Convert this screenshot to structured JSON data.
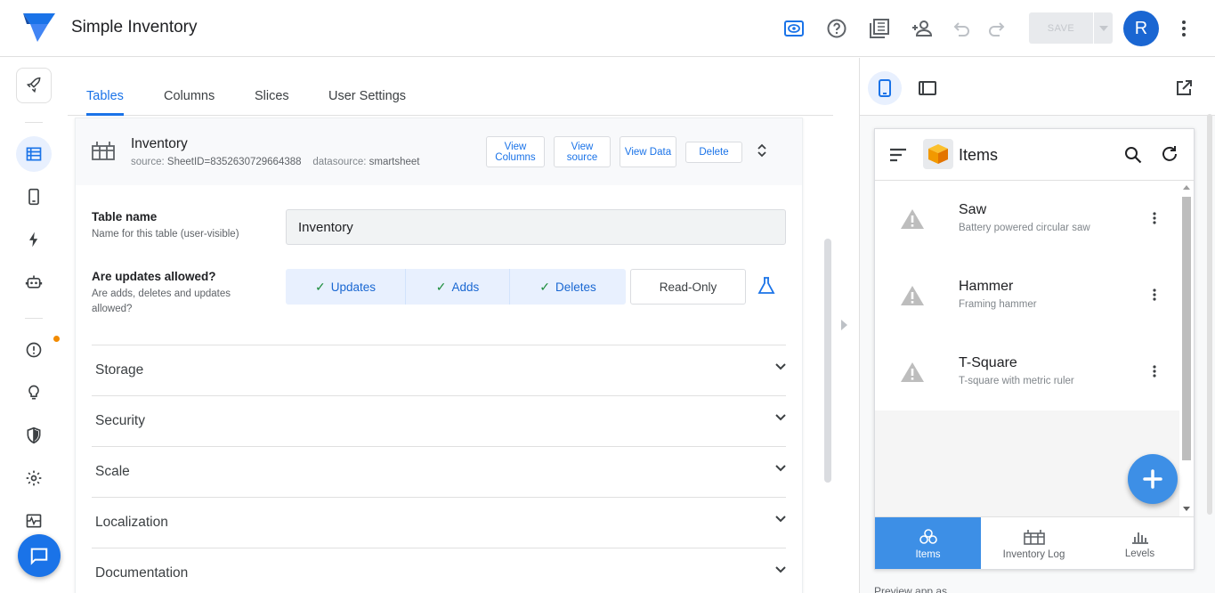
{
  "app": {
    "title": "Simple Inventory",
    "save_label": "SAVE",
    "avatar_initial": "R",
    "accent": "#1a73e8"
  },
  "tabs": [
    {
      "label": "Tables",
      "active": true
    },
    {
      "label": "Columns",
      "active": false
    },
    {
      "label": "Slices",
      "active": false
    },
    {
      "label": "User Settings",
      "active": false
    }
  ],
  "table": {
    "name": "Inventory",
    "source_key": "source:",
    "source_value": "SheetID=8352630729664388",
    "datasource_key": "datasource:",
    "datasource_value": "smartsheet",
    "buttons": {
      "view_columns": "View Columns",
      "view_source": "View source",
      "view_data": "View Data",
      "delete": "Delete"
    }
  },
  "fields": {
    "table_name_label": "Table name",
    "table_name_help": "Name for this table (user-visible)",
    "table_name_value": "Inventory",
    "updates_label": "Are updates allowed?",
    "updates_help": "Are adds, deletes and updates allowed?",
    "updates": "Updates",
    "adds": "Adds",
    "deletes": "Deletes",
    "read_only": "Read-Only"
  },
  "sections": [
    "Storage",
    "Security",
    "Scale",
    "Localization",
    "Documentation"
  ],
  "preview": {
    "view_title": "Items",
    "items": [
      {
        "title": "Saw",
        "subtitle": "Battery powered circular saw"
      },
      {
        "title": "Hammer",
        "subtitle": "Framing hammer"
      },
      {
        "title": "T-Square",
        "subtitle": "T-square with metric ruler"
      }
    ],
    "nav": [
      {
        "label": "Items",
        "active": true
      },
      {
        "label": "Inventory Log",
        "active": false
      },
      {
        "label": "Levels",
        "active": false
      }
    ],
    "footer": "Preview app as"
  }
}
